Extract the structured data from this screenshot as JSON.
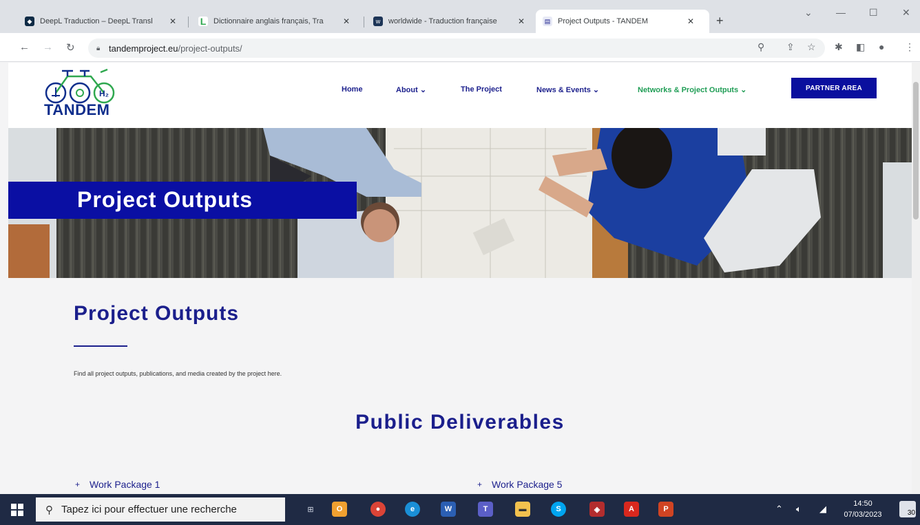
{
  "browser": {
    "tabs": [
      {
        "label": "DeepL Traduction – DeepL Transl",
        "fav_color": "#0f2b46",
        "fav_glyph": "◆"
      },
      {
        "label": "Dictionnaire anglais français, Tra",
        "fav_color": "#ffffff",
        "fav_glyph": "L"
      },
      {
        "label": "worldwide - Traduction française",
        "fav_color": "#1d3557",
        "fav_glyph": "w"
      },
      {
        "label": "Project Outputs - TANDEM",
        "fav_color": "#1b1f8c",
        "fav_glyph": "T"
      }
    ],
    "active_tab": 3,
    "url_host": "tandemproject.eu",
    "url_path": "/project-outputs/"
  },
  "site": {
    "logo_text": "TANDEM",
    "nav": [
      {
        "label": "Home"
      },
      {
        "label": "About ⌄"
      },
      {
        "label": "The Project"
      },
      {
        "label": "News & Events ⌄"
      },
      {
        "label": "Networks & Project Outputs ⌄"
      }
    ],
    "partner_button": "PARTNER AREA",
    "hero_title": "Project Outputs",
    "page_title": "Project Outputs",
    "intro": "Find all project outputs, publications, and media created by the project here.",
    "section_title": "Public Deliverables",
    "work_packages": [
      {
        "label": "Work Package 1"
      },
      {
        "label": "Work Package 5"
      }
    ],
    "accent_color": "#1b1f8c",
    "active_nav_color": "#1f9d55"
  },
  "taskbar": {
    "search_placeholder": "Tapez ici pour effectuer une recherche",
    "time": "14:50",
    "date": "07/03/2023",
    "notification_count": "30"
  }
}
